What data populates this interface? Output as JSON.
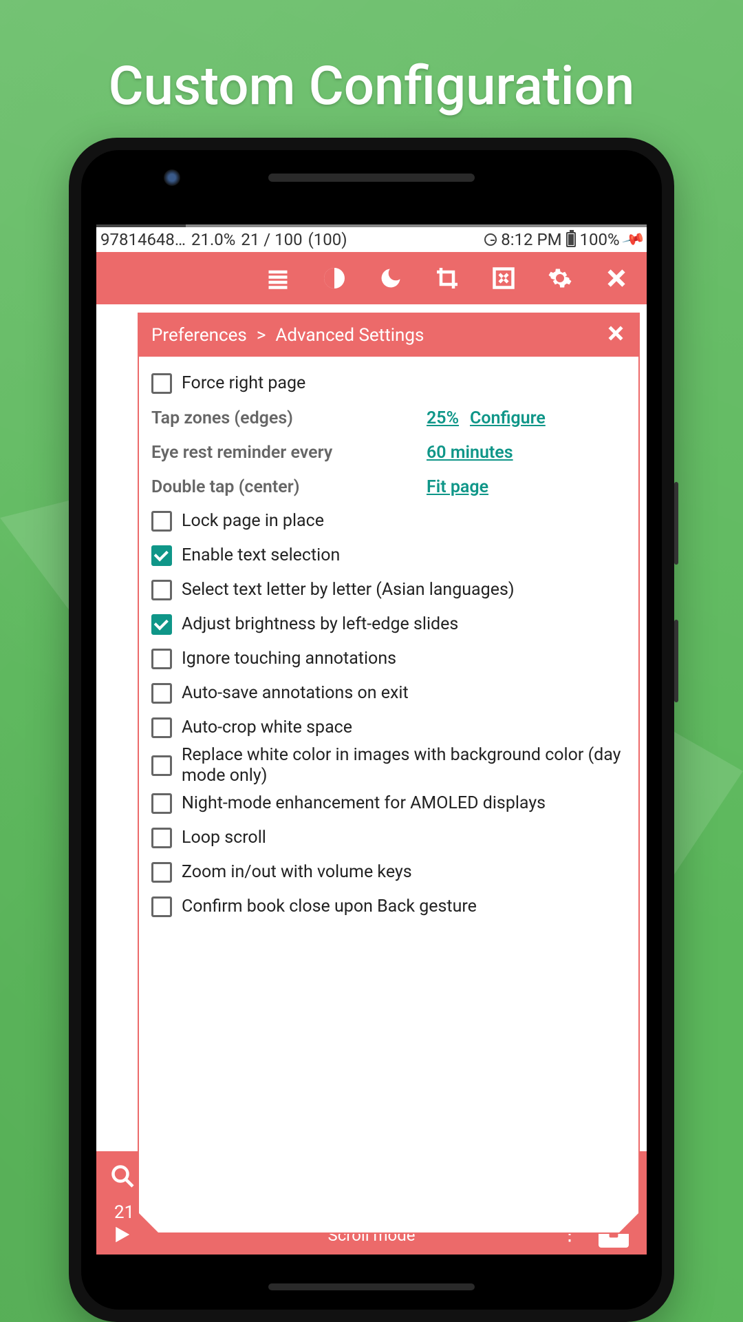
{
  "promo_title": "Custom Configuration",
  "status": {
    "file": "97814648…",
    "zoom": "21.0%",
    "page": "21 / 100",
    "total": "(100)",
    "time": "8:12 PM",
    "battery": "100%"
  },
  "panel": {
    "crumb1": "Preferences",
    "sep": ">",
    "crumb2": "Advanced Settings"
  },
  "rows": {
    "force_right": "Force right page",
    "tap_zones": "Tap zones (edges)",
    "tap_pct": "25%",
    "tap_cfg": "Configure",
    "eye_rest": "Eye rest reminder every",
    "eye_val": "60 minutes",
    "dbl_tap": "Double tap (center)",
    "dbl_val": "Fit page",
    "lock_page": "Lock page in place",
    "enable_sel": "Enable text selection",
    "sel_letter": "Select text letter by letter (Asian languages)",
    "brightness": "Adjust brightness by left-edge slides",
    "ignore_ann": "Ignore touching annotations",
    "autosave": "Auto-save annotations on exit",
    "autocrop": "Auto-crop white space",
    "replace_white": "Replace white color in images with background color (day mode only)",
    "night_amoled": "Night-mode enhancement for AMOLED displays",
    "loop_scroll": "Loop scroll",
    "zoom_vol": "Zoom in/out with volume keys",
    "confirm_close": "Confirm book close upon Back gesture"
  },
  "bottom": {
    "page": "21",
    "mode": "Scroll mode"
  }
}
